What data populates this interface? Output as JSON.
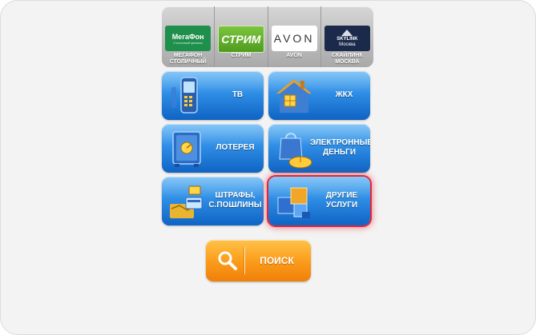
{
  "providers": [
    {
      "logo_line1": "МегаФон",
      "logo_line2": "Столичный филиал",
      "label": "МЕГАФОН СТОЛИЧНЫЙ",
      "icon": "megafon-logo"
    },
    {
      "logo_line1": "СТРИМ",
      "label": "СТРИМ",
      "icon": "strim-logo"
    },
    {
      "logo_line1": "AVON",
      "label": "AVON",
      "icon": "avon-logo"
    },
    {
      "logo_line1": "SKYLINK",
      "logo_line2": "Москва",
      "label": "СКАЙЛИНК МОСКВА",
      "icon": "skylink-logo"
    }
  ],
  "tiles": {
    "tv": {
      "label": "ТВ",
      "icon": "mobile-phone-icon"
    },
    "zhkh": {
      "label": "ЖКХ",
      "icon": "house-icon"
    },
    "lottery": {
      "label": "ЛОТЕРЕЯ",
      "icon": "safe-icon"
    },
    "emoney": {
      "label": "ЭЛЕКТРОННЫЕ ДЕНЬГИ",
      "icon": "shopping-bag-mouse-icon"
    },
    "fines": {
      "label": "ШТРАФЫ, С.ПОШЛИНЫ",
      "icon": "map-card-icon"
    },
    "other": {
      "label": "ДРУГИЕ УСЛУГИ",
      "icon": "cubes-icon",
      "state": "active"
    }
  },
  "search": {
    "label": "ПОИСК",
    "icon": "magnifier-icon"
  },
  "colors": {
    "tile_blue": "#2f8ee5",
    "tile_blue_dark": "#0f63c4",
    "search_orange": "#fb9e1c",
    "active_highlight": "#e0263c",
    "background": "#f3f3f3"
  }
}
